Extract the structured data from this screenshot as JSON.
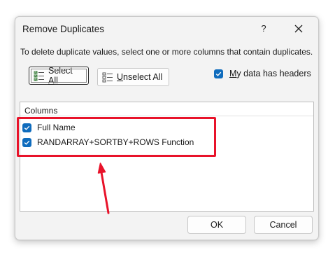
{
  "dialog": {
    "title": "Remove Duplicates",
    "help_label": "?",
    "close_icon": "close-icon",
    "instruction": "To delete duplicate values, select one or more columns that contain duplicates."
  },
  "toolbar": {
    "select_all_prefix": "Select ",
    "select_all_key": "A",
    "select_all_suffix": "ll",
    "select_all_icon": "select-all-icon",
    "unselect_all_key": "U",
    "unselect_all_rest": "nselect All",
    "unselect_all_icon": "unselect-all-icon"
  },
  "headers_option": {
    "key": "M",
    "rest": "y data has headers",
    "checked": true
  },
  "columns_list": {
    "header": "Columns",
    "items": [
      {
        "label": "Full Name",
        "checked": true
      },
      {
        "label": "RANDARRAY+SORTBY+ROWS Function",
        "checked": true
      }
    ]
  },
  "footer": {
    "ok_label": "OK",
    "cancel_label": "Cancel"
  },
  "colors": {
    "checkbox_accent": "#0f6cbd",
    "annotation_red": "#e8132a"
  }
}
